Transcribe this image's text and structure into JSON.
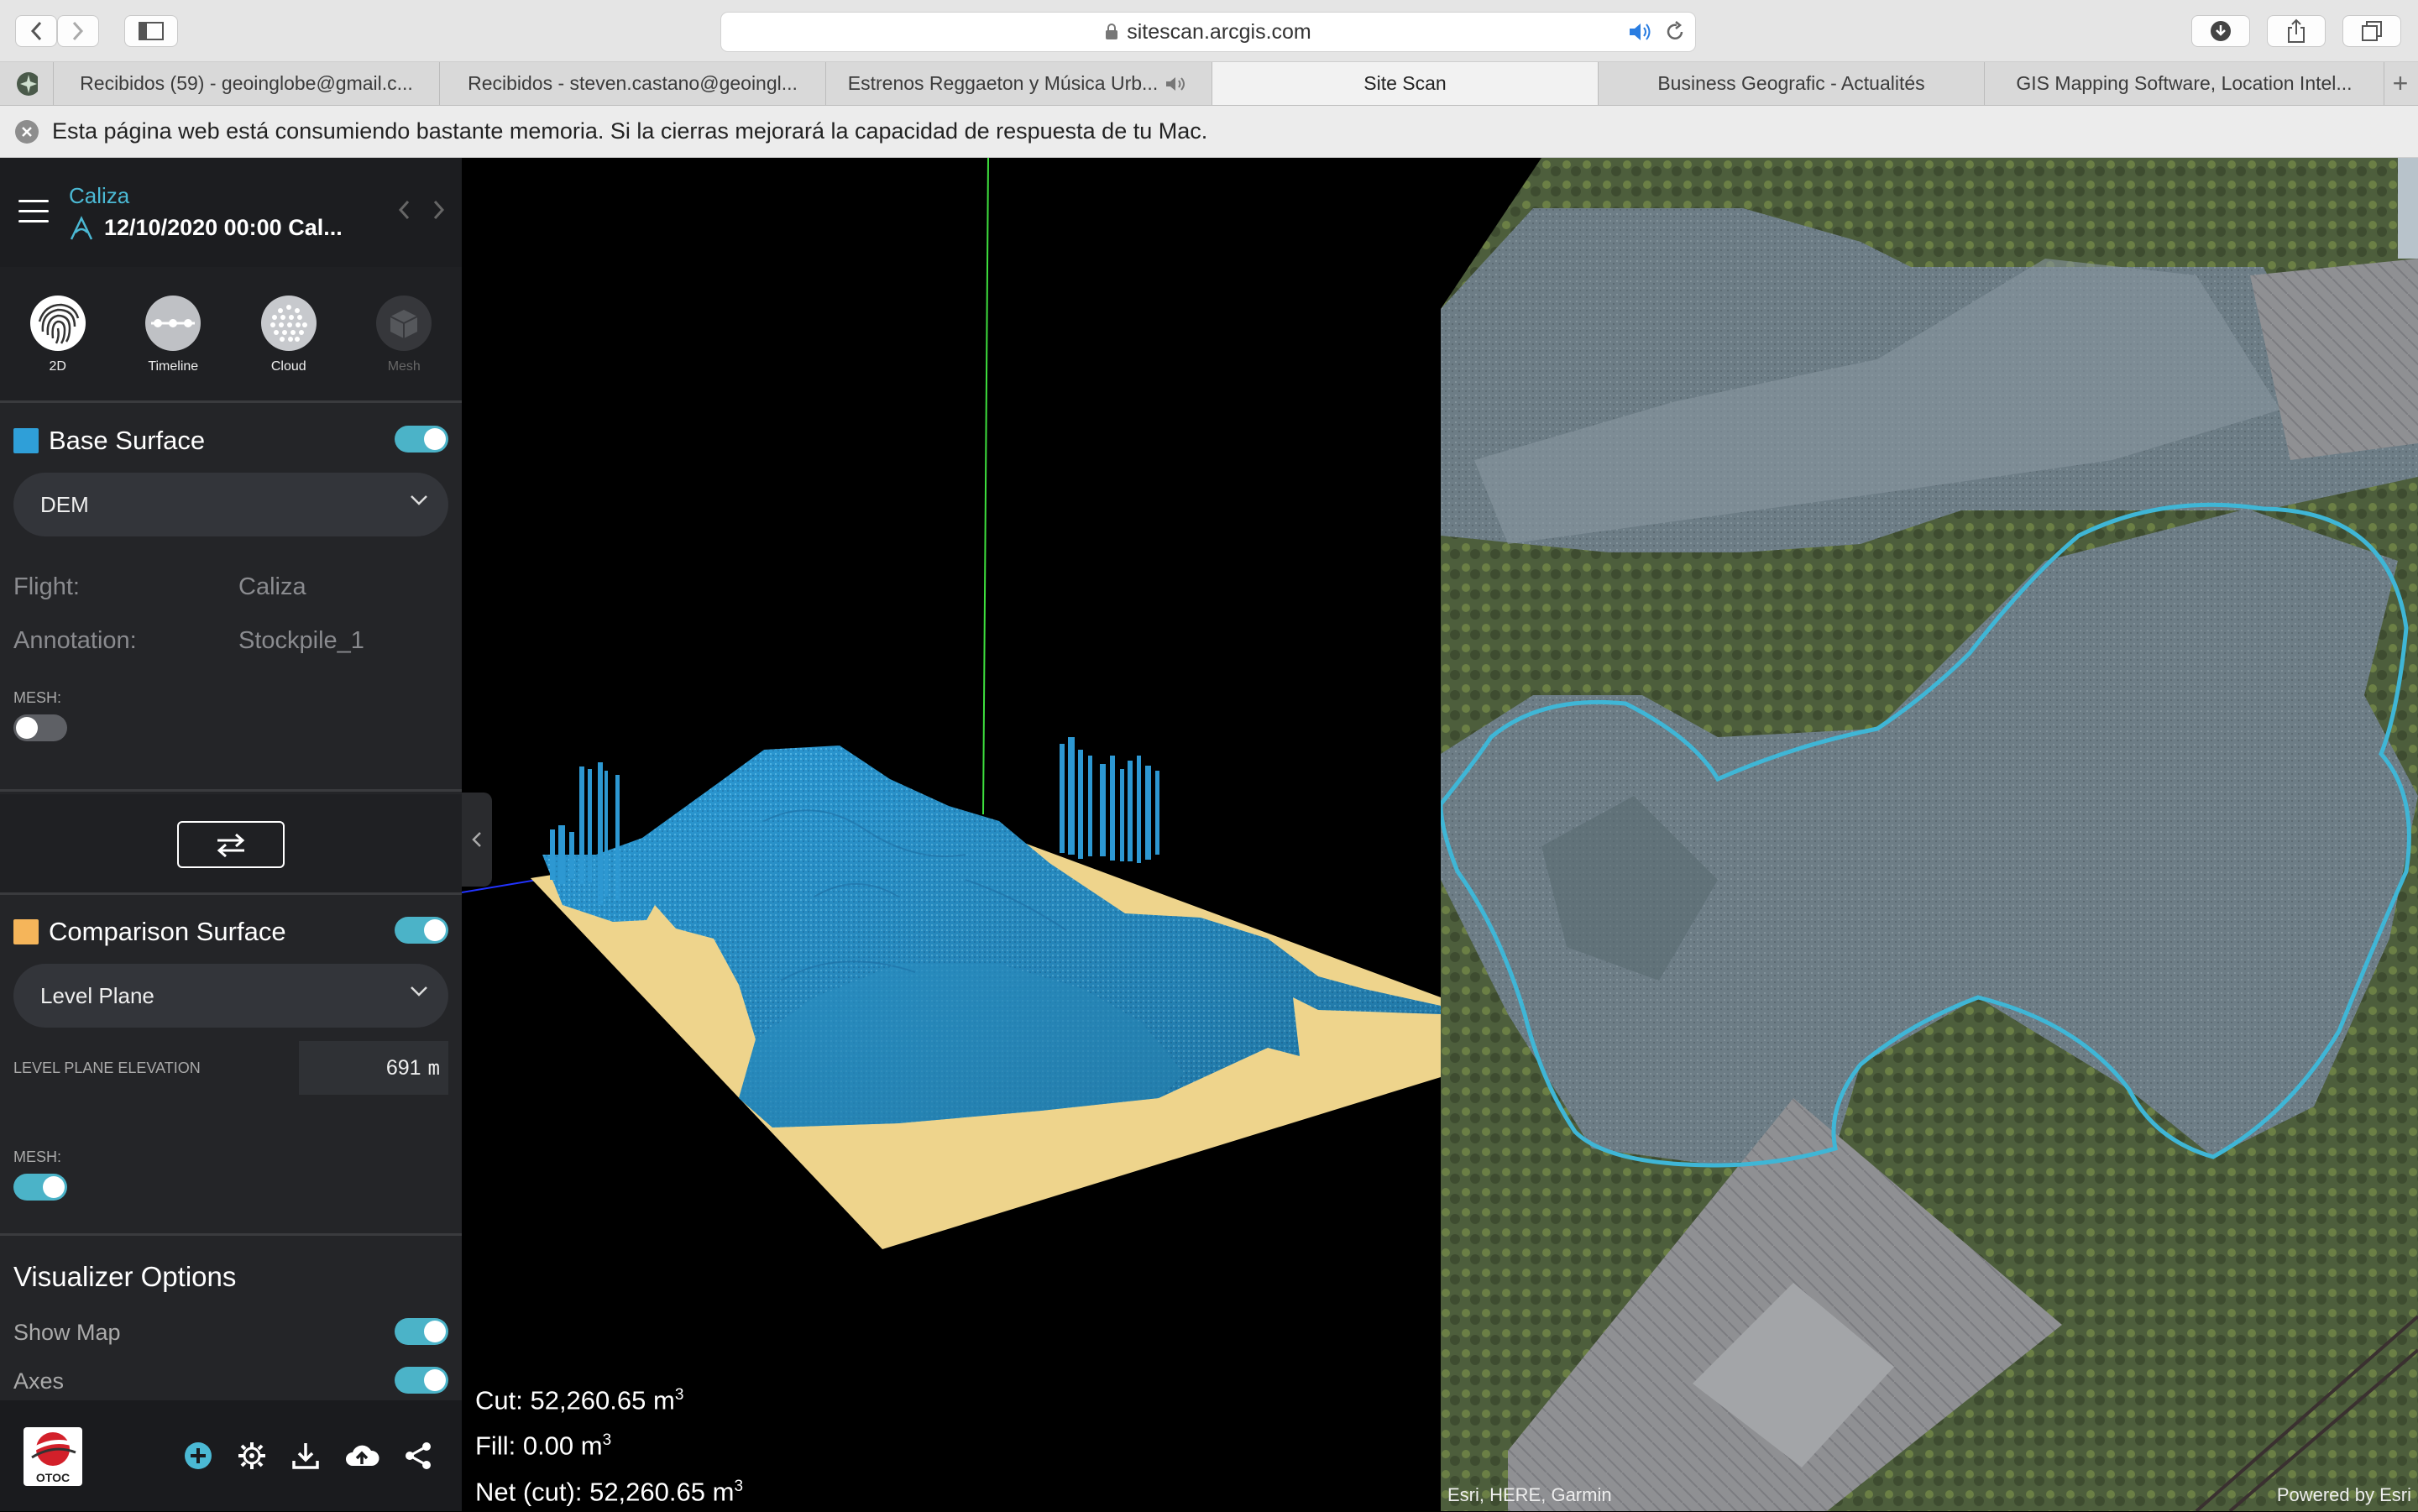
{
  "browser": {
    "url": "sitescan.arcgis.com",
    "tabs": [
      {
        "label": "Recibidos (59) - geoinglobe@gmail.c..."
      },
      {
        "label": "Recibidos - steven.castano@geoingl..."
      },
      {
        "label": "Estrenos Reggaeton y Música Urb..."
      },
      {
        "label": "Site Scan",
        "active": true
      },
      {
        "label": "Business Geografic - Actualités"
      },
      {
        "label": "GIS Mapping Software, Location Intel..."
      }
    ],
    "memory_warning": "Esta página web está consumiendo bastante memoria. Si la cierras mejorará la capacidad de respuesta de tu Mac."
  },
  "sidebar": {
    "project": "Caliza",
    "flight": "12/10/2020 00:00  Cal...",
    "modes": [
      {
        "label": "2D",
        "icon": "fingerprint-icon"
      },
      {
        "label": "Timeline",
        "icon": "timeline-icon"
      },
      {
        "label": "Cloud",
        "icon": "point-cloud-icon"
      },
      {
        "label": "Mesh",
        "icon": "mesh-cube-icon",
        "disabled": true
      }
    ],
    "base_surface": {
      "title": "Base Surface",
      "color": "#2f9fd8",
      "enabled": true,
      "dropdown": "DEM",
      "flight_label": "Flight:",
      "flight_value": "Caliza",
      "annotation_label": "Annotation:",
      "annotation_value": "Stockpile_1",
      "mesh_label": "MESH:",
      "mesh_enabled": false
    },
    "comparison_surface": {
      "title": "Comparison Surface",
      "color": "#f5b55a",
      "enabled": true,
      "dropdown": "Level Plane",
      "elevation_label": "LEVEL PLANE ELEVATION",
      "elevation_value": "691",
      "elevation_unit": "m",
      "mesh_label": "MESH:",
      "mesh_enabled": true
    },
    "visualizer": {
      "title": "Visualizer Options",
      "show_map_label": "Show Map",
      "show_map_enabled": true,
      "axes_label": "Axes",
      "axes_enabled": true
    },
    "footer": {
      "logo_text": "OTOC"
    }
  },
  "viewport": {
    "cut_label": "Cut: 52,260.65 m",
    "fill_label": "Fill: 0.00 m",
    "net_label": "Net (cut): 52,260.65 m",
    "unit_exp": "3",
    "accent_color": "#2b9ad6",
    "plane_color": "#eed48c"
  },
  "map": {
    "attribution_left": "Esri, HERE, Garmin",
    "attribution_right": "Powered by Esri",
    "outline_color": "#3fb6d6"
  }
}
